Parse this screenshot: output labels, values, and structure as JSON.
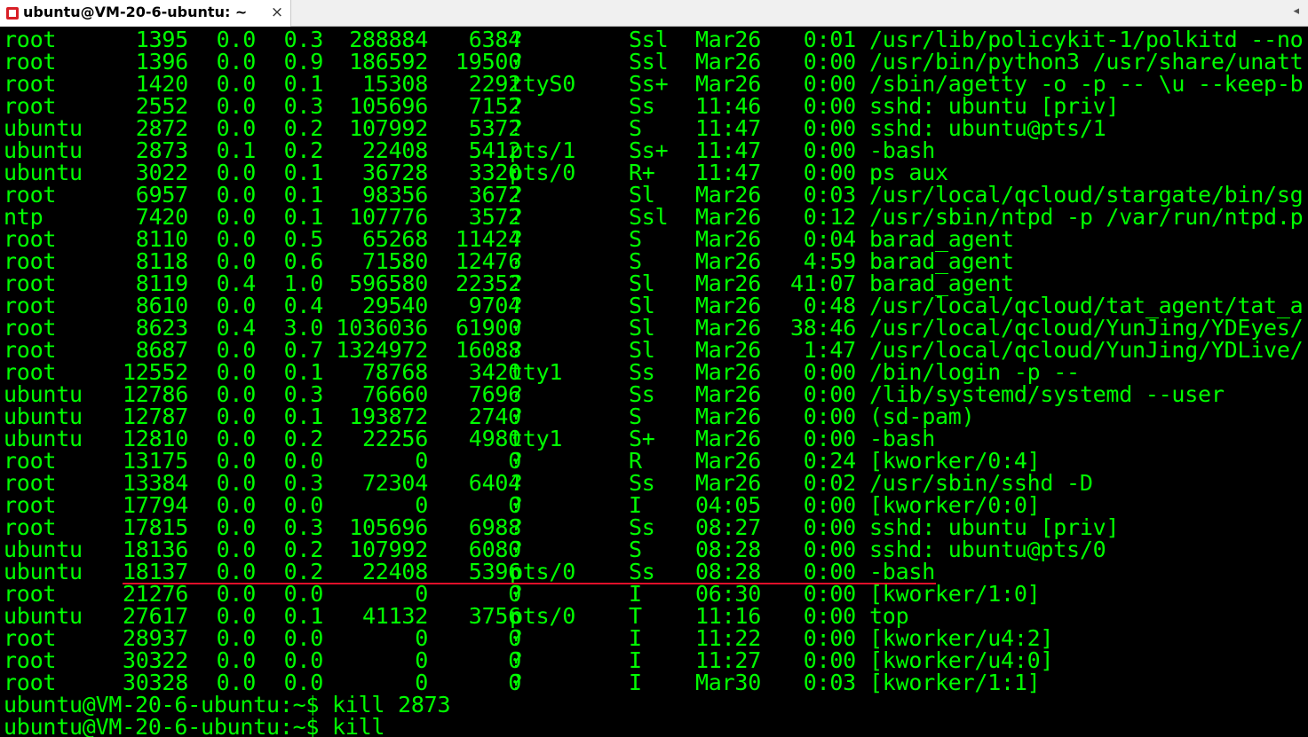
{
  "tab": {
    "title": "ubuntu@VM-20-6-ubuntu: ~",
    "close": "×",
    "scroll_glyph": "◂"
  },
  "process_rows": [
    [
      "root",
      "1395",
      "0.0",
      "0.3",
      "288884",
      "6384",
      "?",
      "Ssl",
      "Mar26",
      "0:01",
      "/usr/lib/policykit-1/polkitd --no"
    ],
    [
      "root",
      "1396",
      "0.0",
      "0.9",
      "186592",
      "19500",
      "?",
      "Ssl",
      "Mar26",
      "0:00",
      "/usr/bin/python3 /usr/share/unatt"
    ],
    [
      "root",
      "1420",
      "0.0",
      "0.1",
      "15308",
      "2292",
      "ttyS0",
      "Ss+",
      "Mar26",
      "0:00",
      "/sbin/agetty -o -p -- \\u --keep-b"
    ],
    [
      "root",
      "2552",
      "0.0",
      "0.3",
      "105696",
      "7152",
      "?",
      "Ss",
      "11:46",
      "0:00",
      "sshd: ubuntu [priv]"
    ],
    [
      "ubuntu",
      "2872",
      "0.0",
      "0.2",
      "107992",
      "5372",
      "?",
      "S",
      "11:47",
      "0:00",
      "sshd: ubuntu@pts/1"
    ],
    [
      "ubuntu",
      "2873",
      "0.1",
      "0.2",
      "22408",
      "5412",
      "pts/1",
      "Ss+",
      "11:47",
      "0:00",
      "-bash"
    ],
    [
      "ubuntu",
      "3022",
      "0.0",
      "0.1",
      "36728",
      "3320",
      "pts/0",
      "R+",
      "11:47",
      "0:00",
      "ps aux"
    ],
    [
      "root",
      "6957",
      "0.0",
      "0.1",
      "98356",
      "3672",
      "?",
      "Sl",
      "Mar26",
      "0:03",
      "/usr/local/qcloud/stargate/bin/sg"
    ],
    [
      "ntp",
      "7420",
      "0.0",
      "0.1",
      "107776",
      "3572",
      "?",
      "Ssl",
      "Mar26",
      "0:12",
      "/usr/sbin/ntpd -p /var/run/ntpd.p"
    ],
    [
      "root",
      "8110",
      "0.0",
      "0.5",
      "65268",
      "11424",
      "?",
      "S",
      "Mar26",
      "0:04",
      "barad_agent"
    ],
    [
      "root",
      "8118",
      "0.0",
      "0.6",
      "71580",
      "12476",
      "?",
      "S",
      "Mar26",
      "4:59",
      "barad_agent"
    ],
    [
      "root",
      "8119",
      "0.4",
      "1.0",
      "596580",
      "22352",
      "?",
      "Sl",
      "Mar26",
      "41:07",
      "barad_agent"
    ],
    [
      "root",
      "8610",
      "0.0",
      "0.4",
      "29540",
      "9704",
      "?",
      "Sl",
      "Mar26",
      "0:48",
      "/usr/local/qcloud/tat_agent/tat_a"
    ],
    [
      "root",
      "8623",
      "0.4",
      "3.0",
      "1036036",
      "61900",
      "?",
      "Sl",
      "Mar26",
      "38:46",
      "/usr/local/qcloud/YunJing/YDEyes/"
    ],
    [
      "root",
      "8687",
      "0.0",
      "0.7",
      "1324972",
      "16088",
      "?",
      "Sl",
      "Mar26",
      "1:47",
      "/usr/local/qcloud/YunJing/YDLive/"
    ],
    [
      "root",
      "12552",
      "0.0",
      "0.1",
      "78768",
      "3420",
      "tty1",
      "Ss",
      "Mar26",
      "0:00",
      "/bin/login -p --"
    ],
    [
      "ubuntu",
      "12786",
      "0.0",
      "0.3",
      "76660",
      "7696",
      "?",
      "Ss",
      "Mar26",
      "0:00",
      "/lib/systemd/systemd --user"
    ],
    [
      "ubuntu",
      "12787",
      "0.0",
      "0.1",
      "193872",
      "2740",
      "?",
      "S",
      "Mar26",
      "0:00",
      "(sd-pam)"
    ],
    [
      "ubuntu",
      "12810",
      "0.0",
      "0.2",
      "22256",
      "4980",
      "tty1",
      "S+",
      "Mar26",
      "0:00",
      "-bash"
    ],
    [
      "root",
      "13175",
      "0.0",
      "0.0",
      "0",
      "0",
      "?",
      "R",
      "Mar26",
      "0:24",
      "[kworker/0:4]"
    ],
    [
      "root",
      "13384",
      "0.0",
      "0.3",
      "72304",
      "6404",
      "?",
      "Ss",
      "Mar26",
      "0:02",
      "/usr/sbin/sshd -D"
    ],
    [
      "root",
      "17794",
      "0.0",
      "0.0",
      "0",
      "0",
      "?",
      "I",
      "04:05",
      "0:00",
      "[kworker/0:0]"
    ],
    [
      "root",
      "17815",
      "0.0",
      "0.3",
      "105696",
      "6988",
      "?",
      "Ss",
      "08:27",
      "0:00",
      "sshd: ubuntu [priv]"
    ],
    [
      "ubuntu",
      "18136",
      "0.0",
      "0.2",
      "107992",
      "6080",
      "?",
      "S",
      "08:28",
      "0:00",
      "sshd: ubuntu@pts/0"
    ],
    [
      "ubuntu",
      "18137",
      "0.0",
      "0.2",
      "22408",
      "5396",
      "pts/0",
      "Ss",
      "08:28",
      "0:00",
      "-bash"
    ],
    [
      "root",
      "21276",
      "0.0",
      "0.0",
      "0",
      "0",
      "?",
      "I",
      "06:30",
      "0:00",
      "[kworker/1:0]"
    ],
    [
      "ubuntu",
      "27617",
      "0.0",
      "0.1",
      "41132",
      "3756",
      "pts/0",
      "T",
      "11:16",
      "0:00",
      "top"
    ],
    [
      "root",
      "28937",
      "0.0",
      "0.0",
      "0",
      "0",
      "?",
      "I",
      "11:22",
      "0:00",
      "[kworker/u4:2]"
    ],
    [
      "root",
      "30322",
      "0.0",
      "0.0",
      "0",
      "0",
      "?",
      "I",
      "11:27",
      "0:00",
      "[kworker/u4:0]"
    ],
    [
      "root",
      "30328",
      "0.0",
      "0.0",
      "0",
      "0",
      "?",
      "I",
      "Mar30",
      "0:03",
      "[kworker/1:1]"
    ]
  ],
  "prompt_lines": [
    "ubuntu@VM-20-6-ubuntu:~$ kill 2873",
    "ubuntu@VM-20-6-ubuntu:~$ kill"
  ],
  "colors": {
    "terminal_bg": "#000000",
    "terminal_fg": "#00ff00",
    "annotation": "#e0102a"
  }
}
